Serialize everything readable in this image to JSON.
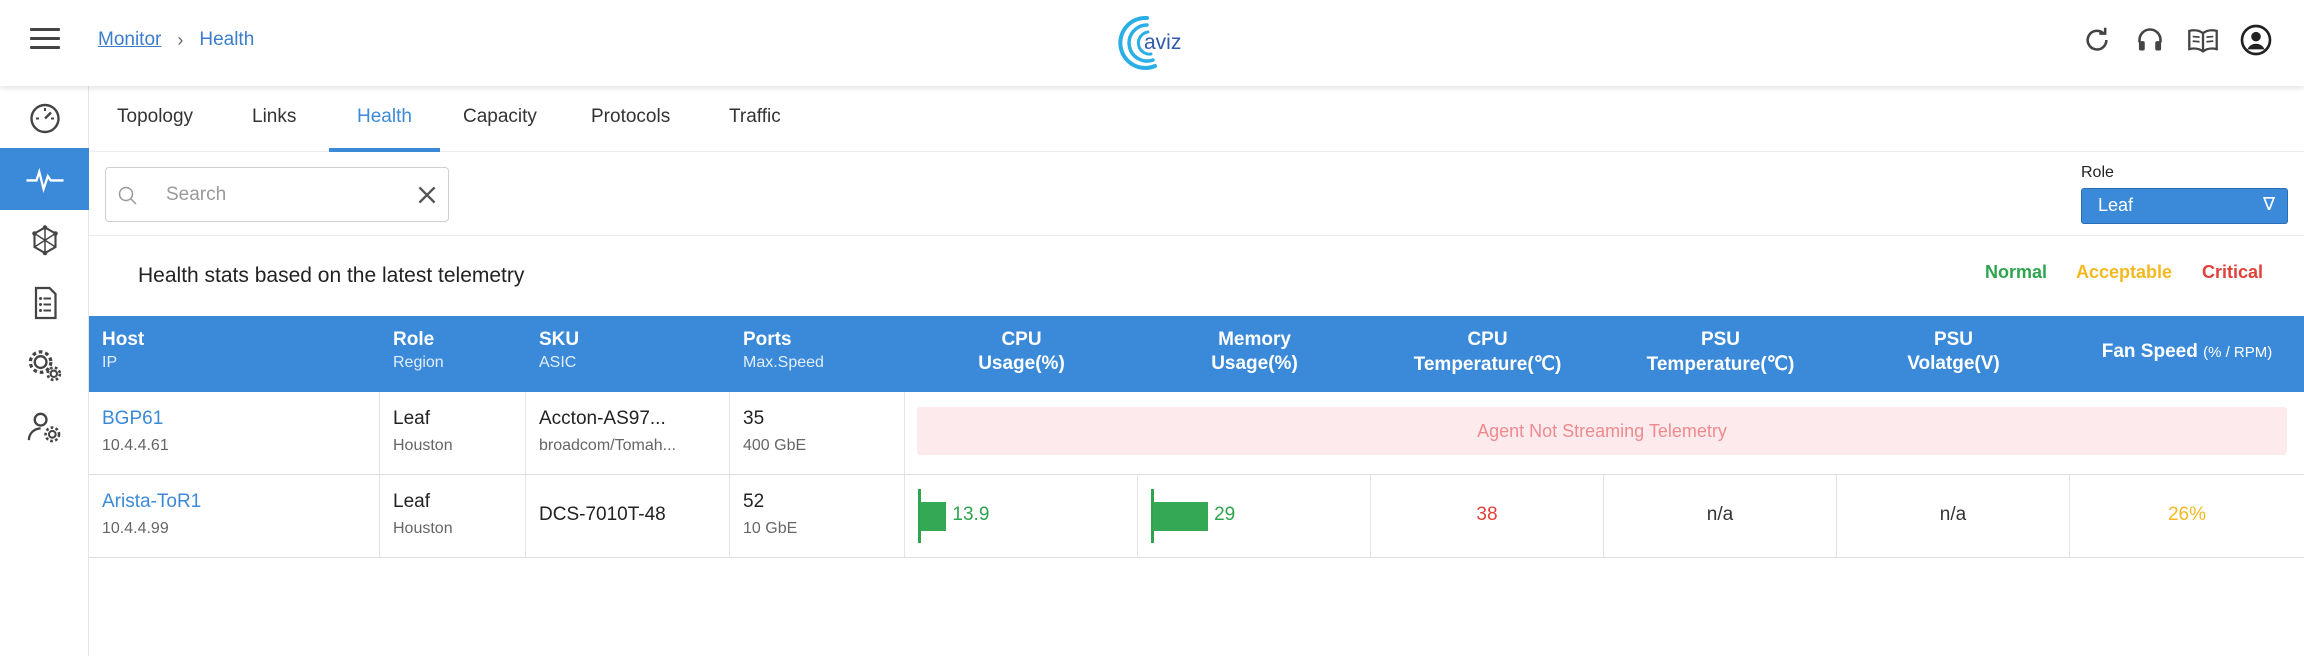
{
  "breadcrumb": {
    "parent": "Monitor",
    "separator": "›",
    "current": "Health"
  },
  "logo_text": "aviz",
  "top_icons": [
    "refresh-icon",
    "headset-icon",
    "book-icon",
    "account-icon"
  ],
  "sidebar": [
    {
      "icon": "dashboard-icon",
      "active": false
    },
    {
      "icon": "pulse-icon",
      "active": true
    },
    {
      "icon": "network-cube-icon",
      "active": false
    },
    {
      "icon": "document-list-icon",
      "active": false
    },
    {
      "icon": "settings-gears-icon",
      "active": false
    },
    {
      "icon": "user-settings-icon",
      "active": false
    }
  ],
  "tabs": [
    "Topology",
    "Links",
    "Health",
    "Capacity",
    "Protocols",
    "Traffic"
  ],
  "active_tab": "Health",
  "search": {
    "placeholder": "Search",
    "value": ""
  },
  "role_filter": {
    "label": "Role",
    "value": "Leaf",
    "arrow": "∇"
  },
  "stats_title": "Health stats based on the latest telemetry",
  "legend": {
    "normal": "Normal",
    "acceptable": "Acceptable",
    "critical": "Critical"
  },
  "colors": {
    "accent": "#3b8ad9",
    "normal": "#2ea44f",
    "acceptable": "#f5b820",
    "critical": "#e0413a"
  },
  "table": {
    "headers": {
      "host": "Host",
      "ip": "IP",
      "role": "Role",
      "region": "Region",
      "sku": "SKU",
      "asic": "ASIC",
      "ports": "Ports",
      "max_speed": "Max.Speed",
      "cpu1": "CPU",
      "cpu2": "Usage(%)",
      "mem1": "Memory",
      "mem2": "Usage(%)",
      "cput1": "CPU",
      "cput2": "Temperature(℃)",
      "psut1": "PSU",
      "psut2": "Temperature(℃)",
      "psuv1": "PSU",
      "psuv2": "Volatge(V)",
      "fan": "Fan Speed",
      "fan_unit": "(% / RPM)"
    },
    "rows": [
      {
        "host": "BGP61",
        "ip": "10.4.4.61",
        "role": "Leaf",
        "region": "Houston",
        "sku": "Accton-AS97...",
        "asic": "broadcom/Tomah...",
        "ports": "35",
        "max_speed": "400 GbE",
        "alert": "Agent Not Streaming Telemetry"
      },
      {
        "host": "Arista-ToR1",
        "ip": "10.4.4.99",
        "role": "Leaf",
        "region": "Houston",
        "sku": "DCS-7010T-48",
        "asic": "",
        "ports": "52",
        "max_speed": "10 GbE",
        "cpu_usage": "13.9",
        "cpu_usage_value": 13.9,
        "mem_usage": "29",
        "mem_usage_value": 29,
        "cpu_temp": "38",
        "psu_temp": "n/a",
        "psu_voltage": "n/a",
        "fan_speed": "26%"
      }
    ]
  }
}
